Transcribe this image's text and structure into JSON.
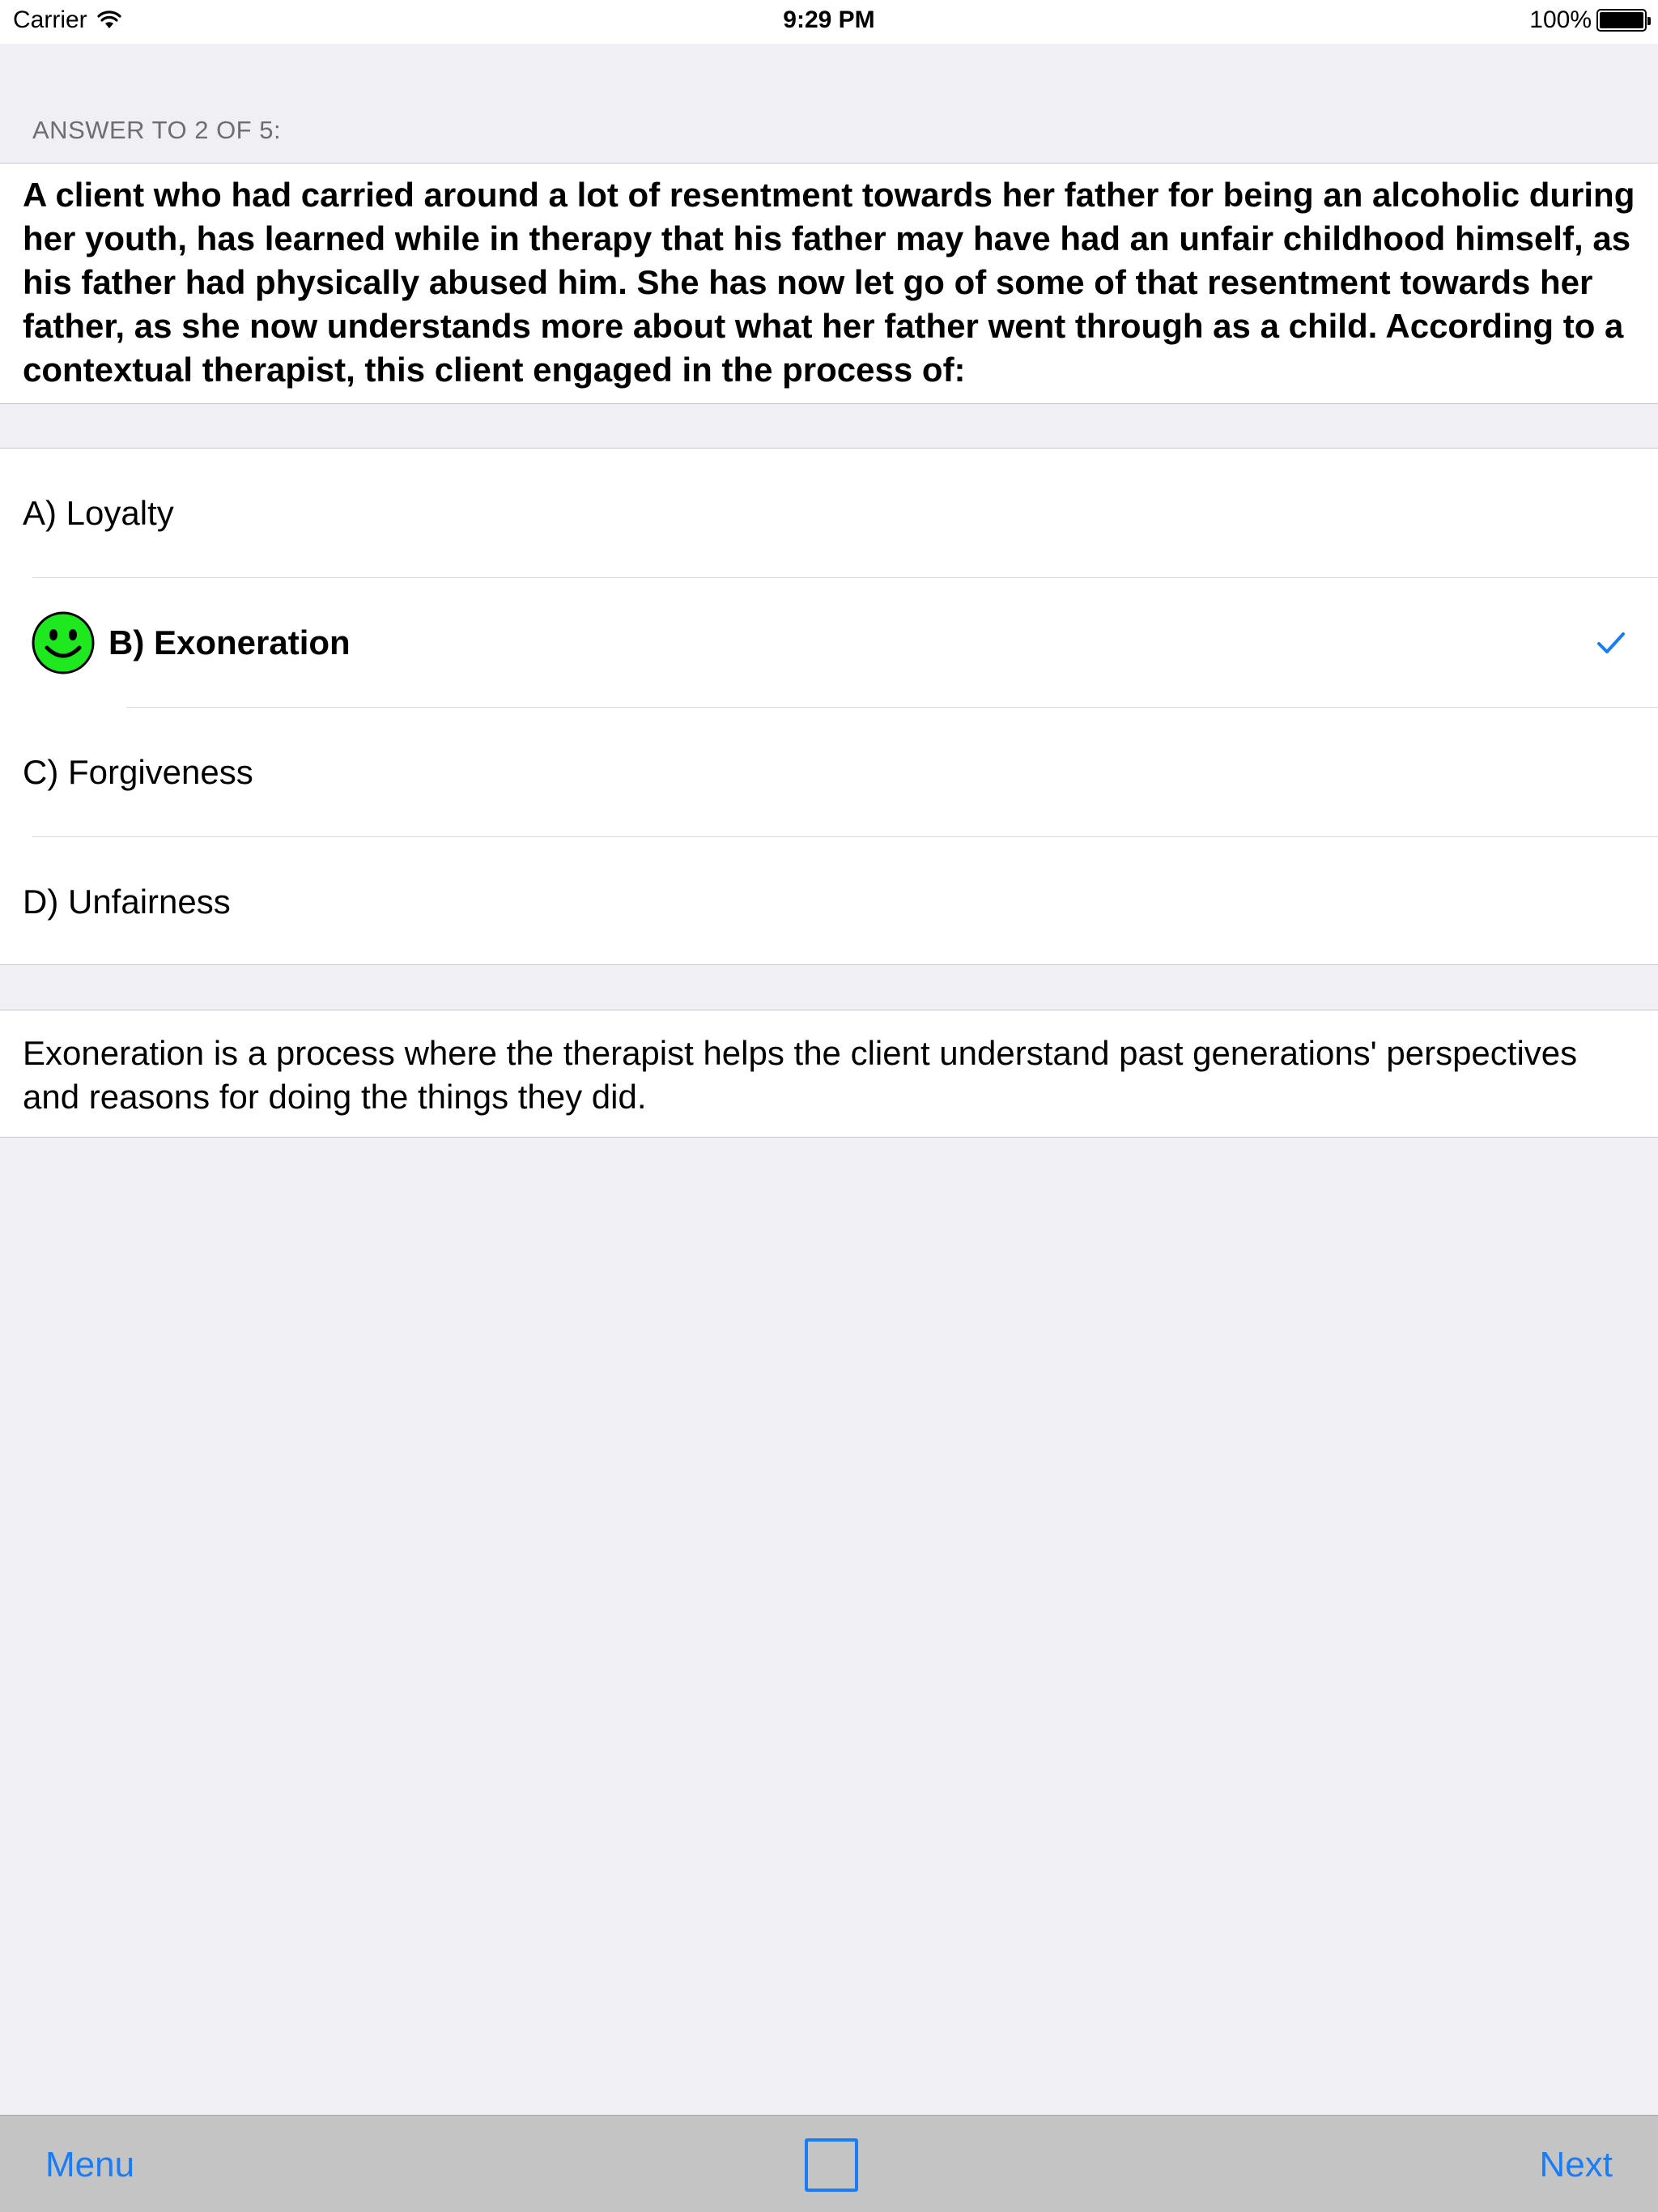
{
  "status_bar": {
    "carrier": "Carrier",
    "time": "9:29 PM",
    "battery": "100%"
  },
  "quiz": {
    "section_header": "ANSWER TO 2 OF 5:",
    "question": "A client who had carried around a lot of resentment towards her father for being an alcoholic during her youth, has learned while in therapy that his father may have had an unfair childhood himself, as his father had physically abused him. She has now let go of some of that resentment towards her father, as she now understands more about what her father went through as a child. According to a contextual therapist, this client engaged in the process of:",
    "answers": [
      {
        "label": "A) Loyalty"
      },
      {
        "label": "B) Exoneration"
      },
      {
        "label": "C) Forgiveness"
      },
      {
        "label": "D) Unfairness"
      }
    ],
    "correct_index": 1,
    "explanation": "Exoneration is a process where the therapist helps the client understand past generations' perspectives and reasons for doing the things they did."
  },
  "toolbar": {
    "menu_label": "Menu",
    "next_label": "Next"
  },
  "colors": {
    "accent": "#1a7cf7",
    "smiley": "#1ee81e",
    "background": "#efeff4"
  }
}
